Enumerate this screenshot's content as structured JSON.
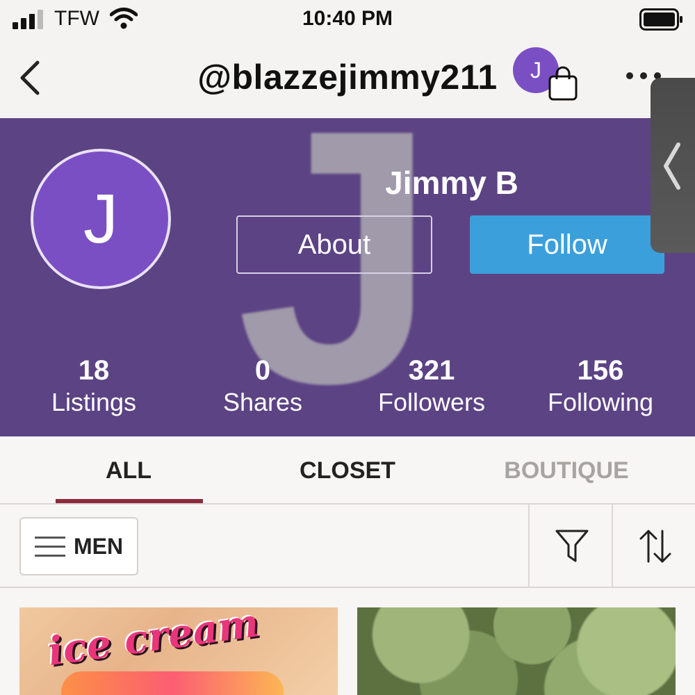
{
  "status_bar": {
    "carrier": "TFW",
    "time": "10:40 PM",
    "signal_icon": "signal-bars-icon",
    "wifi_icon": "wifi-icon",
    "battery_icon": "battery-icon"
  },
  "nav": {
    "back_icon": "chevron-left-icon",
    "title": "@blazzejimmy211",
    "avatar_letter": "J",
    "bag_icon": "shopping-bag-icon",
    "more_icon": "more-horizontal-icon"
  },
  "profile": {
    "avatar_letter": "J",
    "background_letter": "J",
    "name": "Jimmy B",
    "about_label": "About",
    "follow_label": "Follow",
    "stats": [
      {
        "value": "18",
        "label": "Listings"
      },
      {
        "value": "0",
        "label": "Shares"
      },
      {
        "value": "321",
        "label": "Followers"
      },
      {
        "value": "156",
        "label": "Following"
      }
    ]
  },
  "tabs": [
    {
      "label": "ALL",
      "active": true
    },
    {
      "label": "CLOSET",
      "active": false
    },
    {
      "label": "BOUTIQUE",
      "active": false
    }
  ],
  "filter_bar": {
    "department_label": "MEN",
    "menu_icon": "hamburger-menu-icon",
    "filter_icon": "funnel-filter-icon",
    "sort_icon": "sort-arrows-icon"
  },
  "listings": [
    {
      "image_text": "ice cream"
    },
    {
      "image_text": ""
    }
  ],
  "colors": {
    "header_purple": "#5c4384",
    "avatar_purple": "#7b4fc4",
    "follow_blue": "#3b9fdc",
    "tab_underline": "#8b2a3a"
  }
}
